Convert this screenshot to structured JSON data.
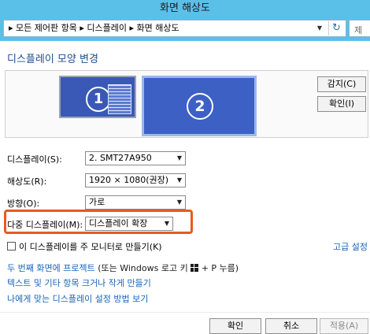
{
  "window": {
    "title": "화면 해상도"
  },
  "address": {
    "crumbs": "▸  모든 제어판 항목  ▸  디스플레이  ▸  화면 해상도",
    "refresh_symbol": "↻",
    "dropdown_symbol": "▼",
    "search_label": "제"
  },
  "main": {
    "heading": "디스플레이 모양 변경",
    "monitors": [
      {
        "number": "1",
        "selected": false
      },
      {
        "number": "2",
        "selected": true
      }
    ],
    "detect_label": "감지(C)",
    "identify_label": "확인(I)",
    "fields": {
      "display": {
        "label": "디스플레이(S):",
        "value": "2. SMT27A950"
      },
      "resolution": {
        "label": "해상도(R):",
        "value": "1920 × 1080(권장)"
      },
      "orientation": {
        "label": "방향(O):",
        "value": "가로"
      },
      "multiple_displays": {
        "label": "다중 디스플레이(M):",
        "value": "디스플레이 확장"
      }
    },
    "dropdown_arrow": "▼",
    "main_display_checkbox": {
      "label": "이 디스플레이를 주 모니터로 만들기(K)",
      "checked": false
    },
    "advanced_link": "고급 설정",
    "links": {
      "project_a": "두 번째 화면에 프로젝트",
      "project_b": "(또는 Windows 로고 키",
      "project_c": "+ P 누름)",
      "text_size": "텍스트 및 기타 항목 크거나 작게 만들기",
      "which_settings": "나에게 맞는 디스플레이 설정 방법 보기"
    }
  },
  "footer": {
    "ok_label": "확인",
    "cancel_label": "취소",
    "apply_label": "적용(A)"
  },
  "colors": {
    "titlebar": "#5ac0e8",
    "highlight": "#e85a1f",
    "link": "#1a63b8",
    "monitor": "#3a58b5"
  }
}
